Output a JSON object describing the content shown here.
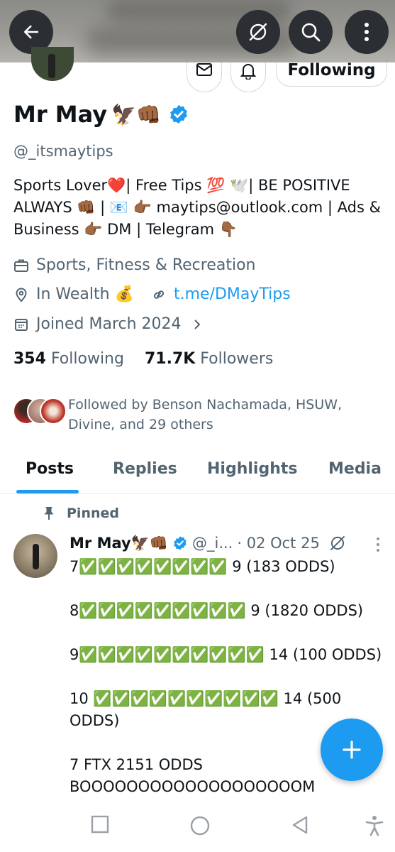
{
  "colors": {
    "accent": "#1d9bf0",
    "text": "#0f1419",
    "secondary": "#536471"
  },
  "top_bar": {
    "icons": [
      "back-arrow-icon",
      "grok-icon",
      "search-icon",
      "more-vertical-icon"
    ]
  },
  "profile": {
    "name": "Mr May",
    "name_emojis": "🦅👊🏾",
    "handle": "@_itsmaytips",
    "bio": "Sports Lover❤️| Free Tips 💯 🕊️| BE POSITIVE ALWAYS 👊🏾 | 📧 👉🏾 maytips@outlook.com | Ads & Business 👉🏾 DM | Telegram 👇🏾",
    "category": "Sports, Fitness & Recreation",
    "location": "In Wealth 💰",
    "website": "t.me/DMayTips",
    "joined": "Joined March 2024",
    "following_count": "354",
    "following_label": "Following",
    "followers_count": "71.7K",
    "followers_label": "Followers",
    "followed_by": "Followed by Benson Nachamada, HSUW, Divine, and 29 others",
    "follow_button": "Following"
  },
  "tabs": [
    "Posts",
    "Replies",
    "Highlights",
    "Media"
  ],
  "active_tab": "Posts",
  "pinned_post": {
    "pinned_label": "Pinned",
    "author": "Mr May",
    "author_emojis": "🦅👊🏾",
    "handle": "@_i...",
    "date": "· 02 Oct 25",
    "body": "7✅✅✅✅✅✅✅✅ 9 (183 ODDS)\n\n8✅✅✅✅✅✅✅✅✅ 9 (1820 ODDS)\n\n9✅✅✅✅✅✅✅✅✅✅ 14 (100 ODDS)\n\n10 ✅✅✅✅✅✅✅✅✅✅ 14 (500 ODDS)\n\n7 FTX 2151 ODDS\nBOOOOOOOOOOOOOOOOOOOM"
  },
  "fab": {
    "icon": "plus-icon"
  },
  "system_nav": [
    "recents-square-icon",
    "home-circle-icon",
    "back-triangle-icon",
    "accessibility-icon"
  ]
}
